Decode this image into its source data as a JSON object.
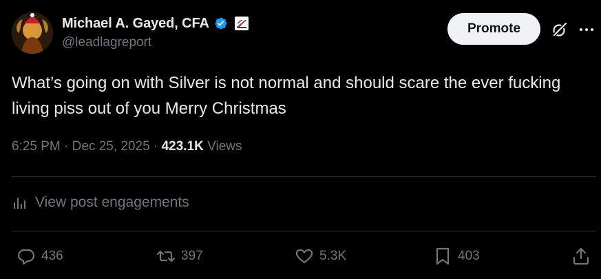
{
  "author": {
    "display_name": "Michael A. Gayed, CFA",
    "handle": "@leadlagreport",
    "verified": true,
    "accent_color": "#1d9bf0"
  },
  "header": {
    "promote_label": "Promote"
  },
  "post": {
    "text": "What’s going on with Silver is not normal and should scare the ever fucking living piss out of you Merry Christmas",
    "time": "6:25 PM",
    "date": "Dec 25, 2025",
    "views_count": "423.1K",
    "views_label": "Views"
  },
  "engagements": {
    "label": "View post engagements"
  },
  "actions": {
    "replies": "436",
    "reposts": "397",
    "likes": "5.3K",
    "bookmarks": "403"
  },
  "icons": {
    "verified": "verified-badge-icon",
    "affiliation": "affiliate-badge-icon",
    "grok": "grok-icon",
    "more": "more-icon",
    "engagements": "analytics-icon",
    "reply": "reply-icon",
    "repost": "repost-icon",
    "like": "like-icon",
    "bookmark": "bookmark-icon",
    "share": "share-icon"
  },
  "colors": {
    "background": "#000000",
    "primary_text": "#e7e9ea",
    "secondary_text": "#71767b",
    "divider": "#2f3336",
    "promote_bg": "#eff3f4"
  }
}
